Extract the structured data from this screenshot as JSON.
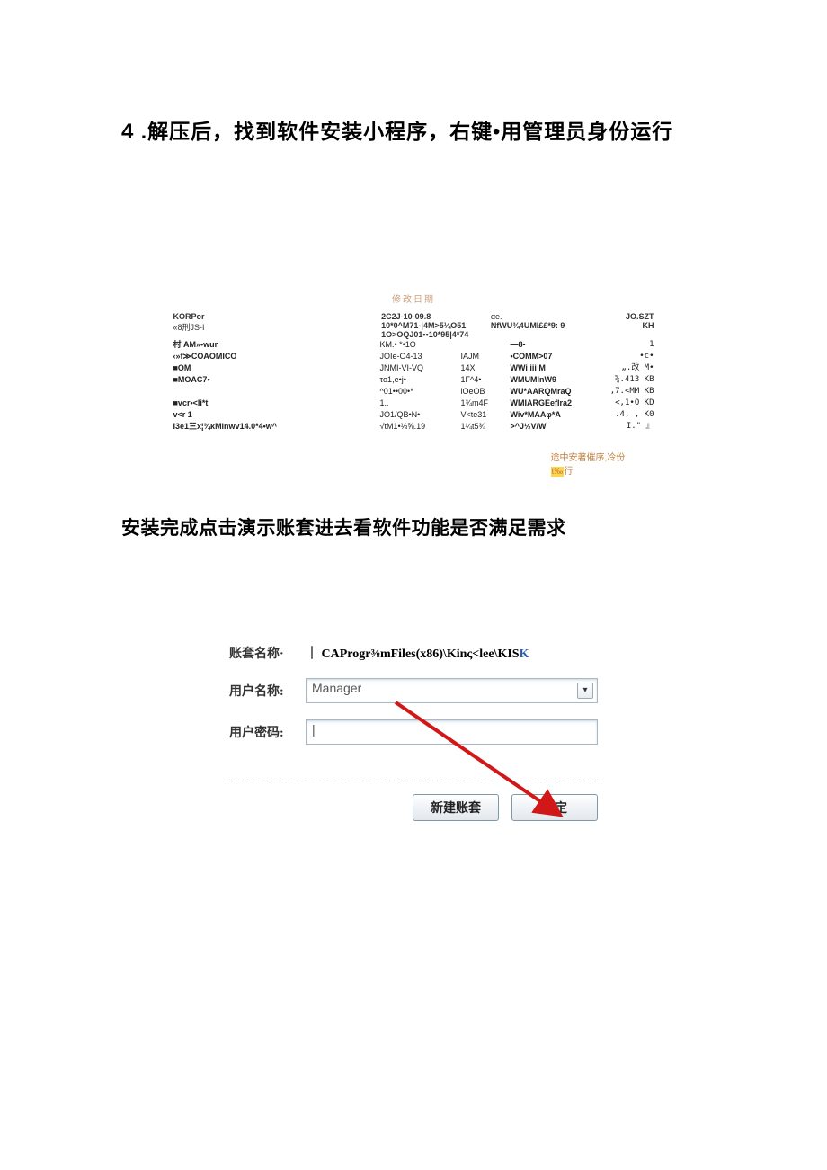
{
  "heading1": {
    "number": "4",
    "text": " .解压后，找到软件安装小程序，右键•用管理员身份运行"
  },
  "filepanel": {
    "title": "修改日期",
    "header": {
      "left1": "KORPor",
      "left2": "«8刑JS-I",
      "mid1": "2C2J-10-09.8",
      "mid2": "10*0^M71-|4M>5¼O51",
      "mid3": "1O>OQJ01••10*95|4*74",
      "r1": "αe.",
      "r2": "NfWU¾4UMI££*9:  9",
      "r3": "JO.SZT",
      "r4": "KH"
    },
    "rows": [
      {
        "c1": "村 AM»•wur",
        "c2": "KM.•  *•1O",
        "c3": "",
        "c4": "—8-",
        "c5": "1"
      },
      {
        "c1": "‹»f≫COAOMICO",
        "c2": "JOIe-O4-13",
        "c3": "IAJM",
        "c4": "•COMM>07",
        "c5": "•c•"
      },
      {
        "c1": "■OM",
        "c2": "JNMI-VI-VQ",
        "c3": "14X",
        "c4": "WWi iii M",
        "c5": "„.改  M•"
      },
      {
        "c1": "■MOAC7•",
        "c2": "τo1,e•j•",
        "c3": "1F^4•",
        "c4": "WMUMInW9",
        "c5": "⅝.413  KB"
      },
      {
        "c1": "",
        "c2": "^01••00•*",
        "c3": "lOeOB",
        "c4": "WU*AARQMraQ",
        "c5": ",7.<MM  KB"
      },
      {
        "c1": "■vcr•<Ii*t",
        "c2": "1..",
        "c3": "1¾m4F",
        "c4": "WMIARGEefIra2",
        "c5": "<,1•O  KD"
      },
      {
        "c1": "v<r                        1",
        "c2": "JO1/QB•N•",
        "c3": "V<te31",
        "c4": "Wiv*MAAφ*A",
        "c5": ".4, ,   K0"
      },
      {
        "c1": "I3e1三x¦¾κMinwv14.0*4•w^",
        "c2": "√tM1•⅓⅝.19",
        "c3": "1¼t5¾",
        "c4": ">^J½V/W",
        "c5": "I.\"  』",
        "highlighted": true
      }
    ]
  },
  "callout": {
    "line1": "途中安著催序,冷份",
    "line2_hl": "t‰",
    "line2_rest": "行"
  },
  "heading2": "安装完成点击演示账套进去看软件功能是否满足需求",
  "login": {
    "label_account": "账套名称·",
    "sep": "｜",
    "path_prefix": "CAProgr⅜mFiles(x86)\\Kinς<lee\\KIS",
    "path_suffix": "K",
    "label_user": "用户名称:",
    "user_value": "Manager",
    "label_pwd": "用户密码:",
    "pwd_value": "|",
    "btn_new": "新建账套",
    "btn_ok": "确定"
  }
}
